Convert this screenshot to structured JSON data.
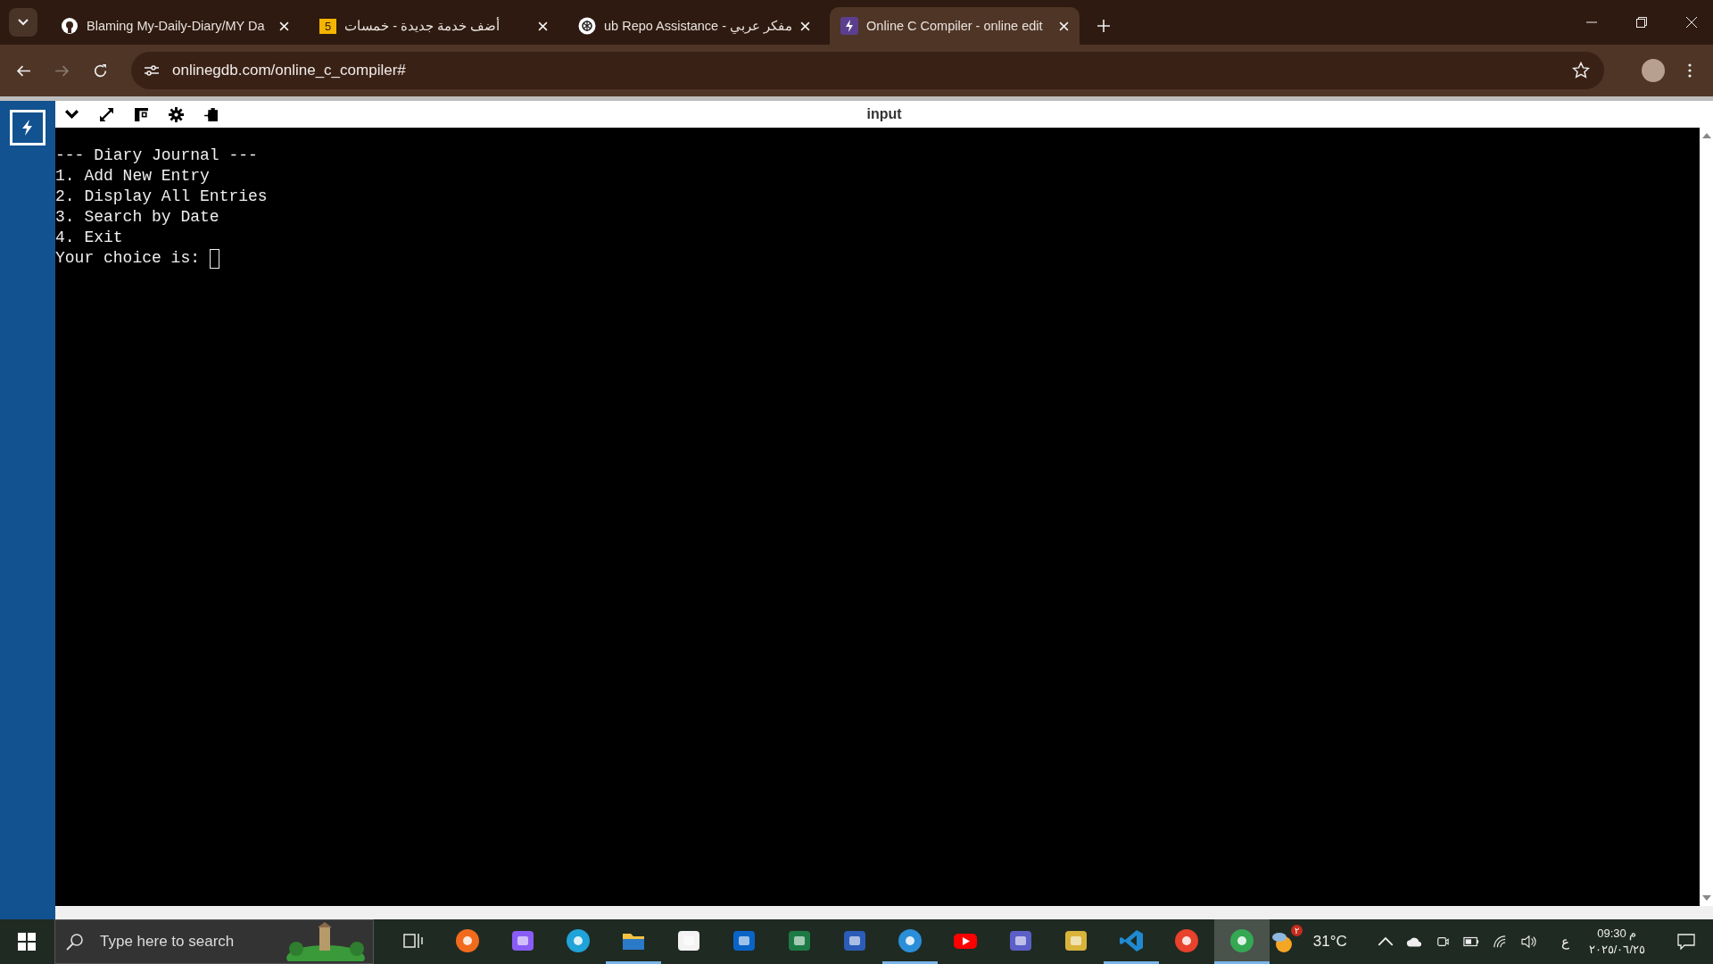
{
  "browser": {
    "tabs": [
      {
        "kind": "github",
        "title": "Blaming My-Daily-Diary/MY Da",
        "selected": false
      },
      {
        "kind": "badge",
        "badge": "5",
        "title": "أضف خدمة جديدة - خمسات",
        "selected": false
      },
      {
        "kind": "openai",
        "title": "ub Repo Assistance - مفكر عربي",
        "selected": false
      },
      {
        "kind": "bolt",
        "title": "Online C Compiler - online edit",
        "selected": true
      }
    ],
    "url": "onlinegdb.com/online_c_compiler#"
  },
  "toolbar": {
    "title": "input"
  },
  "terminal": {
    "lines": [
      "--- Diary Journal ---",
      "1. Add New Entry",
      "2. Display All Entries",
      "3. Search by Date",
      "4. Exit"
    ],
    "prompt": "Your choice is: "
  },
  "taskbar": {
    "search": {
      "placeholder": "Type here to search"
    },
    "apps": [
      {
        "kind": "taskview",
        "running": false,
        "selected": false
      },
      {
        "kind": "firefox",
        "running": false,
        "selected": false
      },
      {
        "kind": "copilot",
        "running": false,
        "selected": false
      },
      {
        "kind": "edge",
        "running": false,
        "selected": false
      },
      {
        "kind": "folder",
        "running": true,
        "selected": false
      },
      {
        "kind": "store",
        "running": false,
        "selected": false
      },
      {
        "kind": "outlook",
        "running": false,
        "selected": false
      },
      {
        "kind": "excel",
        "running": false,
        "selected": false
      },
      {
        "kind": "word",
        "running": false,
        "selected": false
      },
      {
        "kind": "edgebeta",
        "running": true,
        "selected": false
      },
      {
        "kind": "youtube",
        "running": false,
        "selected": false
      },
      {
        "kind": "teams",
        "running": false,
        "selected": false
      },
      {
        "kind": "tool",
        "running": false,
        "selected": false
      },
      {
        "kind": "vscode",
        "running": true,
        "selected": false
      },
      {
        "kind": "wps",
        "running": false,
        "selected": false
      },
      {
        "kind": "chrome",
        "running": true,
        "selected": true
      }
    ],
    "weather": {
      "badge": "٢",
      "temperature": "31°C"
    },
    "language": "ع",
    "time": "09:30 م",
    "date": "٢٠٢٥/٠٦/٢٥"
  }
}
